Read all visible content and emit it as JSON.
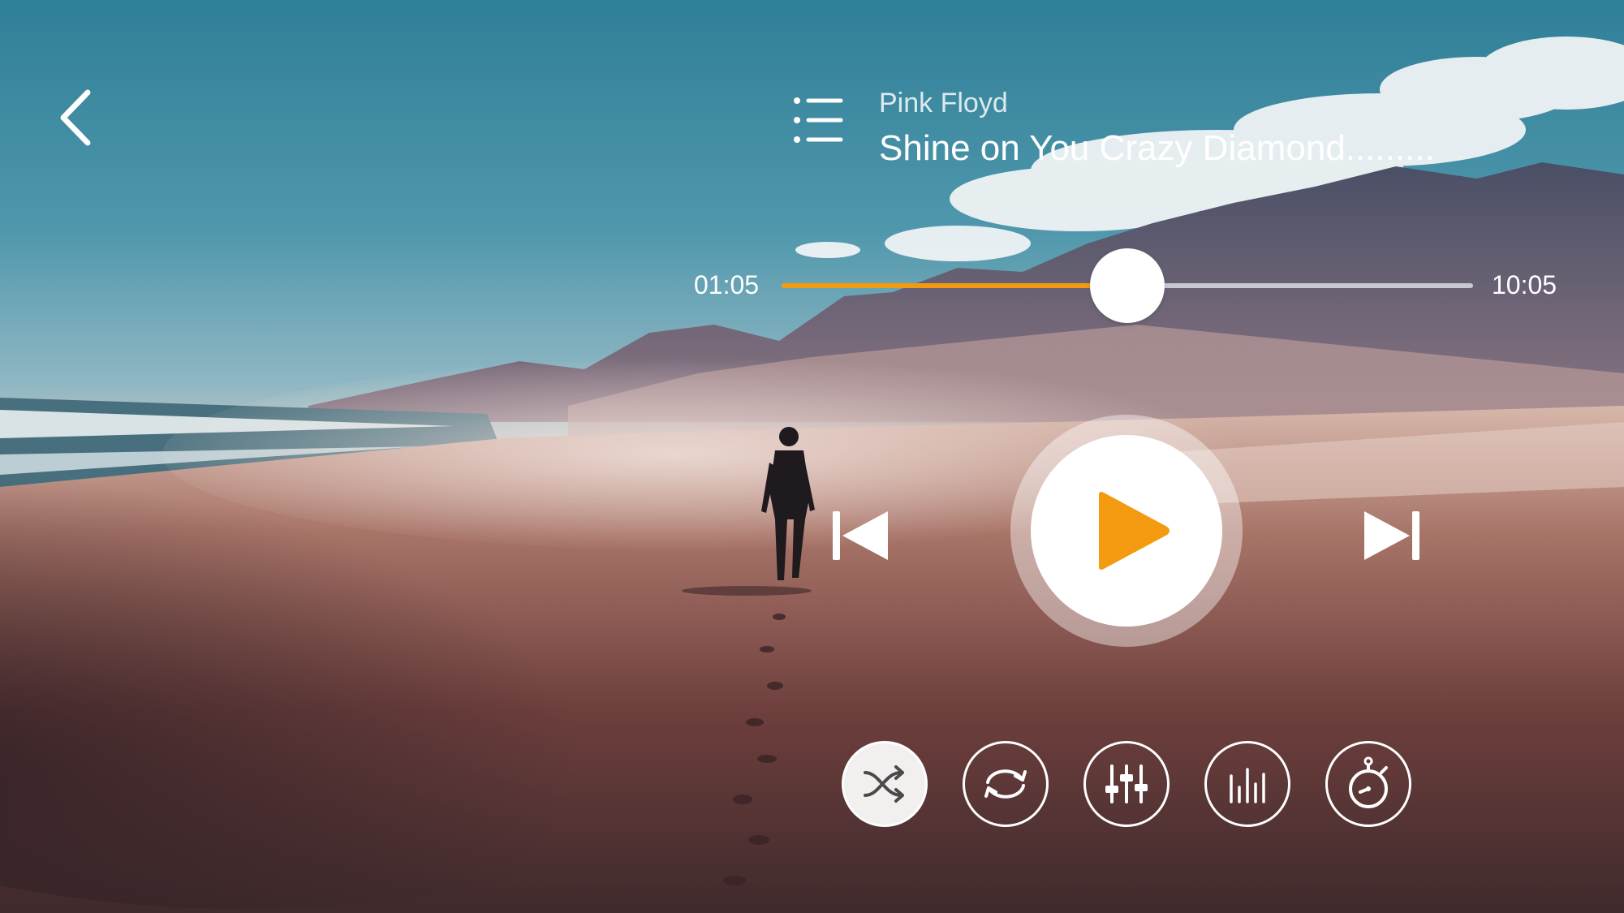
{
  "track": {
    "artist": "Pink Floyd",
    "title": "Shine on You Crazy Diamond........."
  },
  "playback": {
    "current_time": "01:05",
    "total_time": "10:05",
    "progress": 0.5,
    "state": "paused"
  },
  "colors": {
    "accent": "#f39a10",
    "track_inactive": "#d7dce2",
    "control": "#ffffff"
  },
  "icons": {
    "back": "chevron-left-icon",
    "playlist": "list-icon",
    "prev": "skip-previous-icon",
    "play": "play-icon",
    "next": "skip-next-icon",
    "shuffle": "shuffle-icon",
    "repeat": "repeat-icon",
    "equalizer": "equalizer-sliders-icon",
    "spectrum": "spectrum-bars-icon",
    "timer": "stopwatch-icon"
  },
  "controls": {
    "shuffle_active": true
  }
}
